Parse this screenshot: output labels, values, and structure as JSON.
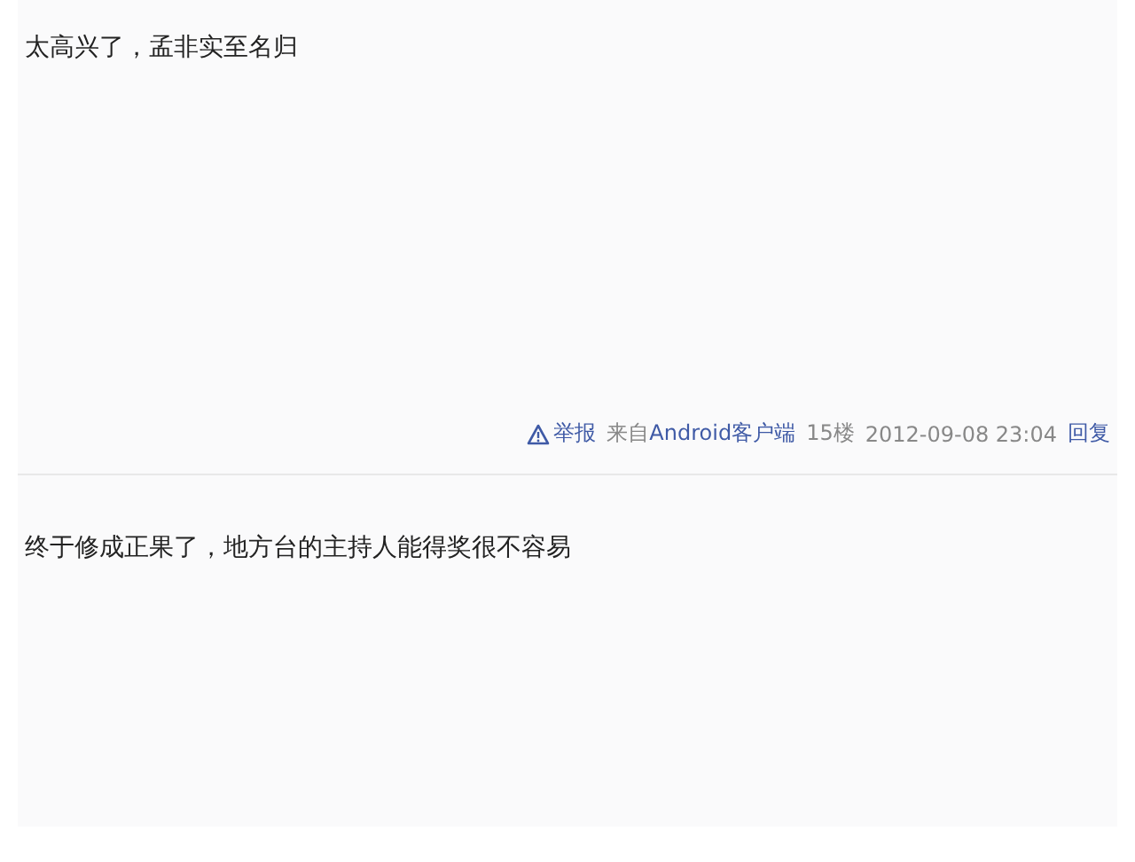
{
  "posts": [
    {
      "content": "太高兴了，孟非实至名归",
      "footer": {
        "report": "举报",
        "source_prefix": "来自",
        "source": "Android客户端",
        "floor": "15楼",
        "time": "2012-09-08 23:04",
        "reply": "回复"
      }
    },
    {
      "content": "终于修成正果了，地方台的主持人能得奖很不容易"
    }
  ]
}
